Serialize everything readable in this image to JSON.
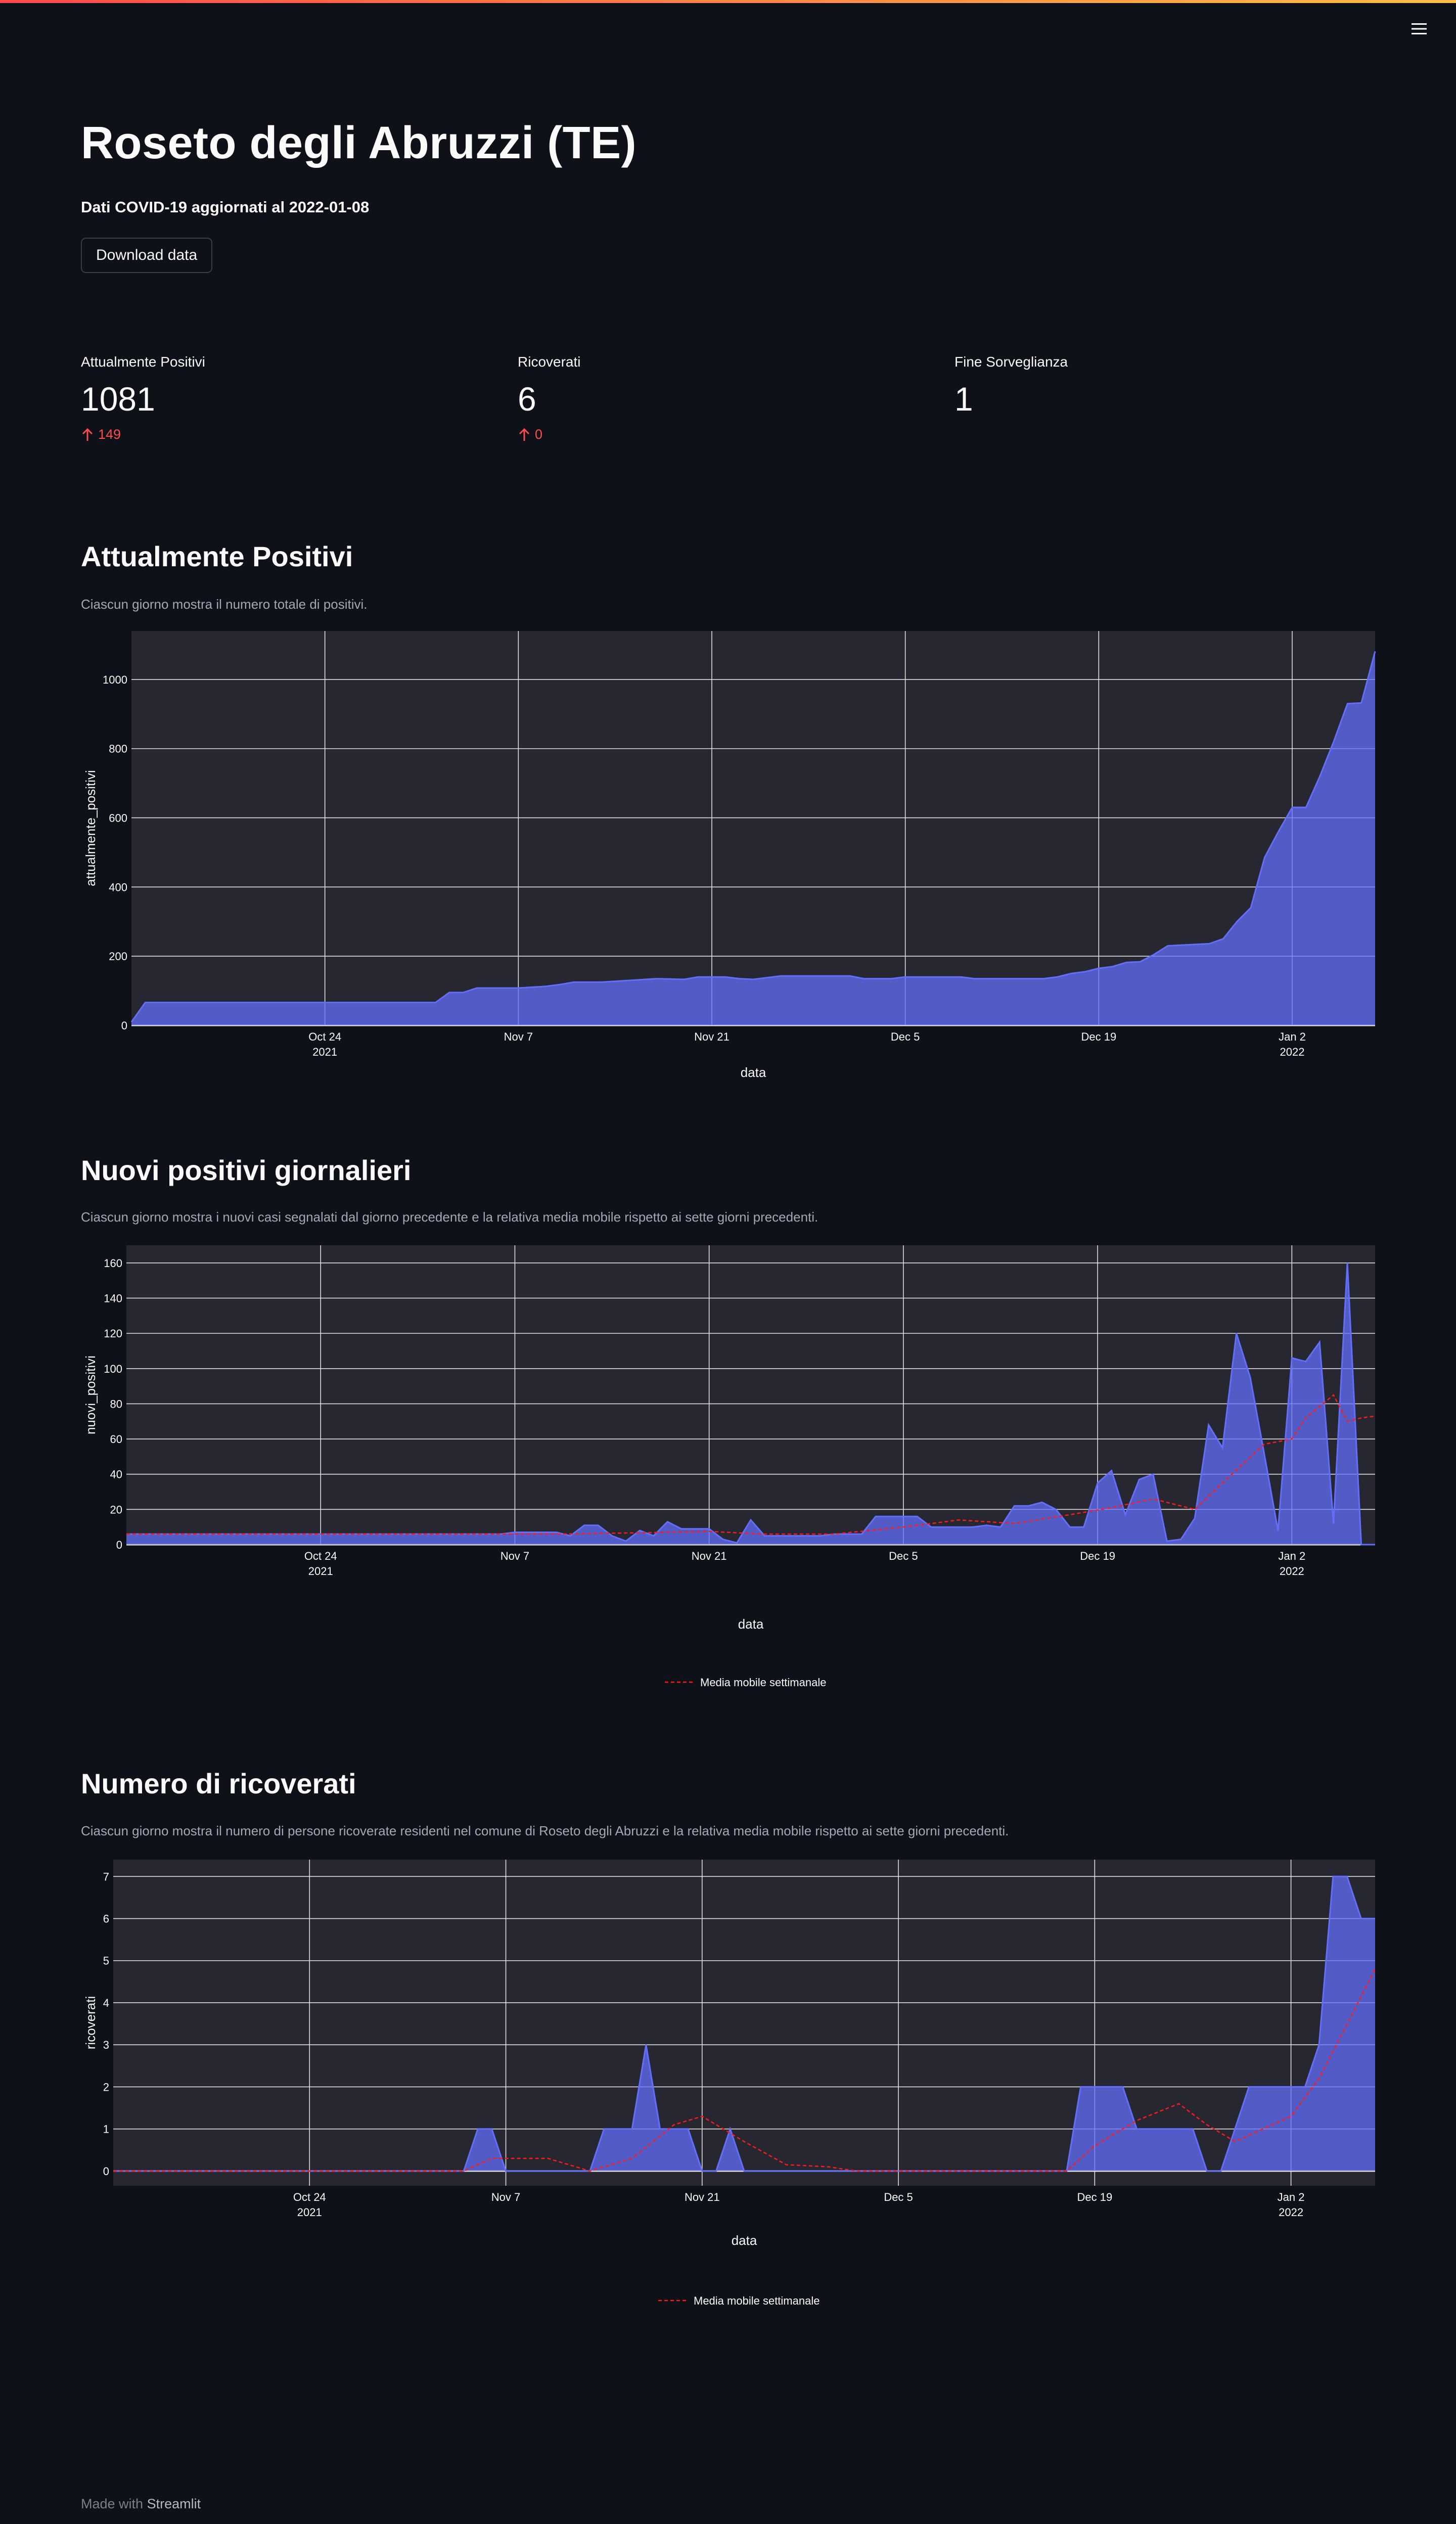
{
  "colors": {
    "accent": "#ff4b4b",
    "fill": "#636efa",
    "ma": "#ff1a1a",
    "plot_bg": "#262730",
    "bg": "#0e1117"
  },
  "header": {
    "menu_icon": "hamburger-icon"
  },
  "page": {
    "title": "Roseto degli Abruzzi (TE)",
    "subtitle": "Dati COVID-19 aggiornati al 2022-01-08",
    "download_label": "Download data"
  },
  "metrics": [
    {
      "label": "Attualmente Positivi",
      "value": "1081",
      "delta": "149"
    },
    {
      "label": "Ricoverati",
      "value": "6",
      "delta": "0"
    },
    {
      "label": "Fine Sorveglianza",
      "value": "1",
      "delta": ""
    }
  ],
  "sections": [
    {
      "title": "Attualmente Positivi",
      "caption": "Ciascun giorno mostra il numero totale di positivi."
    },
    {
      "title": "Nuovi positivi giornalieri",
      "caption": "Ciascun giorno mostra i nuovi casi segnalati dal giorno precedente e la relativa media mobile rispetto ai sette giorni precedenti."
    },
    {
      "title": "Numero di ricoverati",
      "caption": "Ciascun giorno mostra il numero di persone ricoverate residenti nel comune di Roseto degli Abruzzi e la relativa media mobile rispetto ai sette giorni precedenti."
    }
  ],
  "chart_data": [
    {
      "type": "area",
      "title": "",
      "xlabel": "data",
      "ylabel": "attualmente_positivi",
      "x_start": "2021-10-10",
      "x_end": "2022-01-08",
      "ylim": [
        0,
        1140
      ],
      "yticks": [
        0,
        200,
        400,
        600,
        800,
        1000
      ],
      "xticks": [
        {
          "date": "2021-10-24",
          "label": "Oct 24",
          "sub": "2021"
        },
        {
          "date": "2021-11-07",
          "label": "Nov 7",
          "sub": ""
        },
        {
          "date": "2021-11-21",
          "label": "Nov 21",
          "sub": ""
        },
        {
          "date": "2021-12-05",
          "label": "Dec 5",
          "sub": ""
        },
        {
          "date": "2021-12-19",
          "label": "Dec 19",
          "sub": ""
        },
        {
          "date": "2022-01-02",
          "label": "Jan 2",
          "sub": "2022"
        }
      ],
      "grid": true,
      "legend": "",
      "series": [
        {
          "name": "attualmente_positivi",
          "points": [
            [
              "2021-10-10",
              10
            ],
            [
              "2021-10-11",
              66
            ],
            [
              "2021-11-01",
              66
            ],
            [
              "2021-11-02",
              95
            ],
            [
              "2021-11-03",
              95
            ],
            [
              "2021-11-04",
              108
            ],
            [
              "2021-11-07",
              108
            ],
            [
              "2021-11-09",
              113
            ],
            [
              "2021-11-10",
              118
            ],
            [
              "2021-11-11",
              125
            ],
            [
              "2021-11-13",
              125
            ],
            [
              "2021-11-15",
              130
            ],
            [
              "2021-11-17",
              135
            ],
            [
              "2021-11-19",
              133
            ],
            [
              "2021-11-20",
              140
            ],
            [
              "2021-11-22",
              140
            ],
            [
              "2021-11-23",
              135
            ],
            [
              "2021-11-24",
              133
            ],
            [
              "2021-11-26",
              143
            ],
            [
              "2021-12-01",
              143
            ],
            [
              "2021-12-02",
              135
            ],
            [
              "2021-12-04",
              135
            ],
            [
              "2021-12-05",
              140
            ],
            [
              "2021-12-09",
              140
            ],
            [
              "2021-12-10",
              135
            ],
            [
              "2021-12-15",
              135
            ],
            [
              "2021-12-16",
              140
            ],
            [
              "2021-12-17",
              150
            ],
            [
              "2021-12-18",
              155
            ],
            [
              "2021-12-19",
              165
            ],
            [
              "2021-12-20",
              170
            ],
            [
              "2021-12-21",
              182
            ],
            [
              "2021-12-22",
              184
            ],
            [
              "2021-12-23",
              205
            ],
            [
              "2021-12-24",
              230
            ],
            [
              "2021-12-27",
              236
            ],
            [
              "2021-12-28",
              250
            ],
            [
              "2021-12-29",
              300
            ],
            [
              "2021-12-30",
              340
            ],
            [
              "2021-12-31",
              485
            ],
            [
              "2022-01-01",
              560
            ],
            [
              "2022-01-02",
              630
            ],
            [
              "2022-01-03",
              630
            ],
            [
              "2022-01-04",
              720
            ],
            [
              "2022-01-05",
              820
            ],
            [
              "2022-01-06",
              930
            ],
            [
              "2022-01-07",
              932
            ],
            [
              "2022-01-08",
              1081
            ]
          ]
        }
      ]
    },
    {
      "type": "area",
      "title": "",
      "xlabel": "data",
      "ylabel": "nuovi_positivi",
      "x_start": "2021-10-10",
      "x_end": "2022-01-08",
      "ylim": [
        0,
        170
      ],
      "yticks": [
        0,
        20,
        40,
        60,
        80,
        100,
        120,
        140,
        160
      ],
      "xticks": [
        {
          "date": "2021-10-24",
          "label": "Oct 24",
          "sub": "2021"
        },
        {
          "date": "2021-11-07",
          "label": "Nov 7",
          "sub": ""
        },
        {
          "date": "2021-11-21",
          "label": "Nov 21",
          "sub": ""
        },
        {
          "date": "2021-12-05",
          "label": "Dec 5",
          "sub": ""
        },
        {
          "date": "2021-12-19",
          "label": "Dec 19",
          "sub": ""
        },
        {
          "date": "2022-01-02",
          "label": "Jan 2",
          "sub": "2022"
        }
      ],
      "grid": true,
      "legend": "Media mobile settimanale",
      "series": [
        {
          "name": "nuovi_positivi",
          "points": [
            [
              "2021-10-10",
              6
            ],
            [
              "2021-11-06",
              6
            ],
            [
              "2021-11-07",
              7
            ],
            [
              "2021-11-10",
              7
            ],
            [
              "2021-11-11",
              5
            ],
            [
              "2021-11-12",
              11
            ],
            [
              "2021-11-13",
              11
            ],
            [
              "2021-11-14",
              5
            ],
            [
              "2021-11-15",
              2
            ],
            [
              "2021-11-16",
              8
            ],
            [
              "2021-11-17",
              5
            ],
            [
              "2021-11-18",
              13
            ],
            [
              "2021-11-19",
              9
            ],
            [
              "2021-11-21",
              9
            ],
            [
              "2021-11-22",
              3
            ],
            [
              "2021-11-23",
              1
            ],
            [
              "2021-11-24",
              14
            ],
            [
              "2021-11-25",
              5
            ],
            [
              "2021-11-29",
              5
            ],
            [
              "2021-11-30",
              6
            ],
            [
              "2021-12-02",
              6
            ],
            [
              "2021-12-03",
              16
            ],
            [
              "2021-12-06",
              16
            ],
            [
              "2021-12-07",
              10
            ],
            [
              "2021-12-10",
              10
            ],
            [
              "2021-12-11",
              11
            ],
            [
              "2021-12-12",
              10
            ],
            [
              "2021-12-13",
              22
            ],
            [
              "2021-12-14",
              22
            ],
            [
              "2021-12-15",
              24
            ],
            [
              "2021-12-16",
              20
            ],
            [
              "2021-12-17",
              10
            ],
            [
              "2021-12-18",
              10
            ],
            [
              "2021-12-19",
              35
            ],
            [
              "2021-12-20",
              42
            ],
            [
              "2021-12-21",
              17
            ],
            [
              "2021-12-22",
              37
            ],
            [
              "2021-12-23",
              40
            ],
            [
              "2021-12-24",
              2
            ],
            [
              "2021-12-25",
              3
            ],
            [
              "2021-12-26",
              15
            ],
            [
              "2021-12-27",
              68
            ],
            [
              "2021-12-28",
              55
            ],
            [
              "2021-12-29",
              120
            ],
            [
              "2021-12-30",
              95
            ],
            [
              "2021-12-31",
              52
            ],
            [
              "2022-01-01",
              8
            ],
            [
              "2022-01-02",
              106
            ],
            [
              "2022-01-03",
              104
            ],
            [
              "2022-01-04",
              115
            ],
            [
              "2022-01-05",
              12
            ],
            [
              "2022-01-06",
              160
            ],
            [
              "2022-01-07",
              0
            ],
            [
              "2022-01-08",
              0
            ]
          ]
        },
        {
          "name": "Media mobile settimanale",
          "dashed": true,
          "points": [
            [
              "2021-10-10",
              6
            ],
            [
              "2021-11-10",
              6
            ],
            [
              "2021-11-14",
              6.5
            ],
            [
              "2021-11-18",
              7
            ],
            [
              "2021-11-21",
              7.5
            ],
            [
              "2021-11-25",
              6
            ],
            [
              "2021-11-30",
              6
            ],
            [
              "2021-12-05",
              10
            ],
            [
              "2021-12-09",
              14
            ],
            [
              "2021-12-13",
              12
            ],
            [
              "2021-12-17",
              17
            ],
            [
              "2021-12-20",
              21
            ],
            [
              "2021-12-23",
              26
            ],
            [
              "2021-12-26",
              20
            ],
            [
              "2021-12-28",
              35
            ],
            [
              "2021-12-31",
              57
            ],
            [
              "2022-01-02",
              60
            ],
            [
              "2022-01-03",
              72
            ],
            [
              "2022-01-05",
              85
            ],
            [
              "2022-01-06",
              70
            ],
            [
              "2022-01-07",
              72
            ],
            [
              "2022-01-08",
              73
            ]
          ]
        }
      ]
    },
    {
      "type": "area",
      "title": "",
      "xlabel": "data",
      "ylabel": "ricoverati",
      "x_start": "2021-10-10",
      "x_end": "2022-01-08",
      "ylim": [
        -0.35,
        7.4
      ],
      "yticks": [
        0,
        1,
        2,
        3,
        4,
        5,
        6,
        7
      ],
      "xticks": [
        {
          "date": "2021-10-24",
          "label": "Oct 24",
          "sub": "2021"
        },
        {
          "date": "2021-11-07",
          "label": "Nov 7",
          "sub": ""
        },
        {
          "date": "2021-11-21",
          "label": "Nov 21",
          "sub": ""
        },
        {
          "date": "2021-12-05",
          "label": "Dec 5",
          "sub": ""
        },
        {
          "date": "2021-12-19",
          "label": "Dec 19",
          "sub": ""
        },
        {
          "date": "2022-01-02",
          "label": "Jan 2",
          "sub": "2022"
        }
      ],
      "grid": true,
      "legend": "Media mobile settimanale",
      "series": [
        {
          "name": "ricoverati",
          "points": [
            [
              "2021-10-10",
              0
            ],
            [
              "2021-11-04",
              0
            ],
            [
              "2021-11-05",
              1
            ],
            [
              "2021-11-06",
              1
            ],
            [
              "2021-11-07",
              0
            ],
            [
              "2021-11-13",
              0
            ],
            [
              "2021-11-14",
              1
            ],
            [
              "2021-11-16",
              1
            ],
            [
              "2021-11-17",
              3
            ],
            [
              "2021-11-18",
              1
            ],
            [
              "2021-11-20",
              1
            ],
            [
              "2021-11-21",
              0
            ],
            [
              "2021-11-22",
              0
            ],
            [
              "2021-11-23",
              1
            ],
            [
              "2021-11-24",
              0
            ],
            [
              "2021-12-17",
              0
            ],
            [
              "2021-12-18",
              2
            ],
            [
              "2021-12-21",
              2
            ],
            [
              "2021-12-22",
              1
            ],
            [
              "2021-12-26",
              1
            ],
            [
              "2021-12-27",
              0
            ],
            [
              "2021-12-28",
              0
            ],
            [
              "2021-12-29",
              1
            ],
            [
              "2021-12-30",
              2
            ],
            [
              "2022-01-03",
              2
            ],
            [
              "2022-01-04",
              3
            ],
            [
              "2022-01-05",
              7
            ],
            [
              "2022-01-06",
              7
            ],
            [
              "2022-01-07",
              6
            ],
            [
              "2022-01-08",
              6
            ]
          ]
        },
        {
          "name": "Media mobile settimanale",
          "dashed": true,
          "points": [
            [
              "2021-10-10",
              0
            ],
            [
              "2021-11-04",
              0
            ],
            [
              "2021-11-06",
              0.3
            ],
            [
              "2021-11-10",
              0.3
            ],
            [
              "2021-11-13",
              0
            ],
            [
              "2021-11-16",
              0.3
            ],
            [
              "2021-11-19",
              1.1
            ],
            [
              "2021-11-21",
              1.3
            ],
            [
              "2021-11-24",
              0.7
            ],
            [
              "2021-11-27",
              0.15
            ],
            [
              "2021-11-30",
              0.1
            ],
            [
              "2021-12-02",
              0
            ],
            [
              "2021-12-17",
              0
            ],
            [
              "2021-12-19",
              0.6
            ],
            [
              "2021-12-22",
              1.2
            ],
            [
              "2021-12-25",
              1.6
            ],
            [
              "2021-12-27",
              1.1
            ],
            [
              "2021-12-29",
              0.7
            ],
            [
              "2021-12-31",
              1.0
            ],
            [
              "2022-01-02",
              1.3
            ],
            [
              "2022-01-04",
              2.2
            ],
            [
              "2022-01-06",
              3.5
            ],
            [
              "2022-01-08",
              4.8
            ]
          ]
        }
      ]
    }
  ]
}
